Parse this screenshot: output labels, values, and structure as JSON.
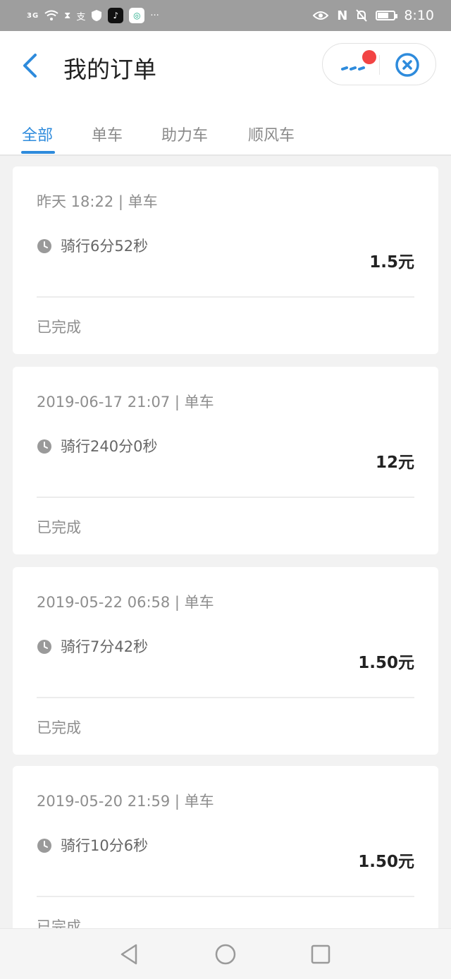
{
  "status_bar": {
    "signal": "3G",
    "time": "8:10",
    "icons": [
      "signal-icon",
      "wifi-icon",
      "hourglass-icon",
      "alipay-icon",
      "shield-icon",
      "tiktok-icon",
      "browser-icon",
      "more-dots-icon",
      "eye-icon",
      "nfc-icon",
      "mute-icon",
      "battery-icon"
    ]
  },
  "header": {
    "title": "我的订单",
    "back_icon": "chevron-left-icon",
    "more_icon": "more-dots-icon",
    "close_icon": "close-circle-icon"
  },
  "tabs": [
    {
      "label": "全部",
      "active": true
    },
    {
      "label": "单车",
      "active": false
    },
    {
      "label": "助力车",
      "active": false
    },
    {
      "label": "顺风车",
      "active": false
    }
  ],
  "orders": [
    {
      "meta": "昨天 18:22 | 单车",
      "duration": "骑行6分52秒",
      "price": "1.5元",
      "status": "已完成"
    },
    {
      "meta": "2019-06-17 21:07 | 单车",
      "duration": "骑行240分0秒",
      "price": "12元",
      "status": "已完成"
    },
    {
      "meta": "2019-05-22 06:58 | 单车",
      "duration": "骑行7分42秒",
      "price": "1.50元",
      "status": "已完成"
    },
    {
      "meta": "2019-05-20 21:59 | 单车",
      "duration": "骑行10分6秒",
      "price": "1.50元",
      "status": "已完成"
    }
  ],
  "colors": {
    "accent": "#2e8bdc",
    "badge": "#f24444",
    "status_bar": "#9e9e9e"
  },
  "nav": [
    "back-triangle-icon",
    "home-circle-icon",
    "recents-square-icon"
  ]
}
